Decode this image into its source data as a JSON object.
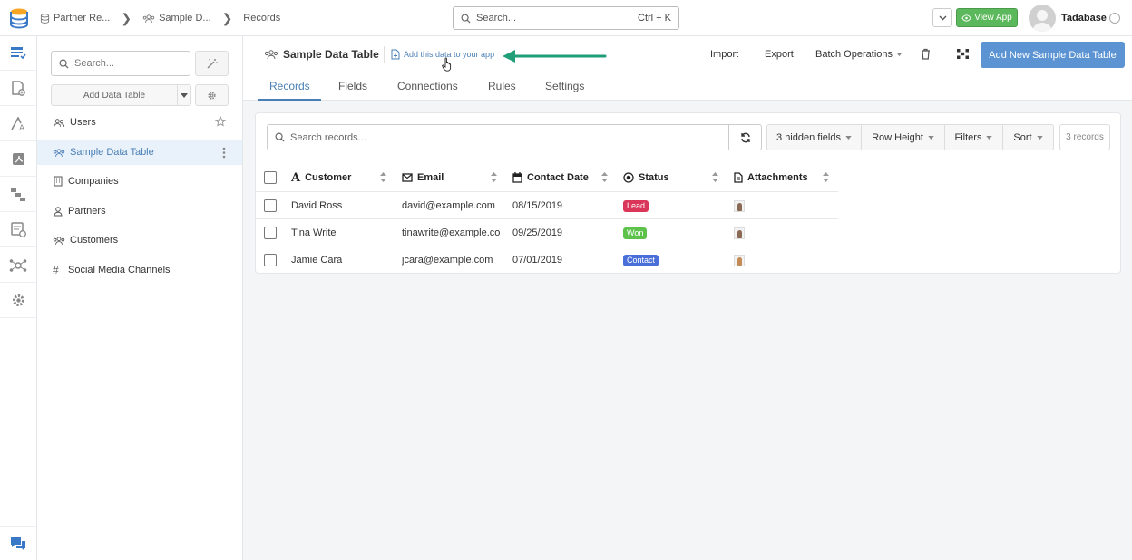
{
  "topbar": {
    "breadcrumbs": [
      {
        "label": "Partner Re...",
        "icon": "database-icon"
      },
      {
        "label": "Sample D...",
        "icon": "users-icon"
      },
      {
        "label": "Records",
        "icon": ""
      }
    ],
    "search": {
      "placeholder": "Search...",
      "shortcut": "Ctrl + K"
    },
    "view_app_label": "View App",
    "user_name": "Tadabase"
  },
  "rail": {
    "items": [
      "data-tables-icon",
      "pages-icon",
      "components-icon",
      "pdf-icon",
      "pipes-icon",
      "tasks-icon",
      "integrations-icon",
      "settings-icon"
    ],
    "bottom": "chat-icon"
  },
  "panel": {
    "search_placeholder": "Search...",
    "add_table_label": "Add Data Table",
    "tables": [
      {
        "label": "Users",
        "icon": "users-icon",
        "active": false
      },
      {
        "label": "Sample Data Table",
        "icon": "users-icon",
        "active": true
      },
      {
        "label": "Companies",
        "icon": "building-icon",
        "active": false
      },
      {
        "label": "Partners",
        "icon": "person-icon",
        "active": false
      },
      {
        "label": "Customers",
        "icon": "users-icon",
        "active": false
      },
      {
        "label": "Social Media Channels",
        "icon": "hash-icon",
        "active": false
      }
    ]
  },
  "header": {
    "title": "Sample Data Table",
    "add_link": "Add this data to your app",
    "import_label": "Import",
    "export_label": "Export",
    "batch_label": "Batch Operations",
    "add_new_label": "Add New Sample Data Table"
  },
  "tabs": [
    "Records",
    "Fields",
    "Connections",
    "Rules",
    "Settings"
  ],
  "toolbar": {
    "search_placeholder": "Search records...",
    "hidden_fields": "3 hidden fields",
    "row_height": "Row Height",
    "filters": "Filters",
    "sort": "Sort",
    "count": "3 records"
  },
  "columns": [
    {
      "label": "Customer",
      "icon": "text-icon"
    },
    {
      "label": "Email",
      "icon": "email-icon"
    },
    {
      "label": "Contact Date",
      "icon": "calendar-icon"
    },
    {
      "label": "Status",
      "icon": "radio-icon"
    },
    {
      "label": "Attachments",
      "icon": "file-icon"
    }
  ],
  "rows": [
    {
      "customer": "David Ross",
      "email": "david@example.com",
      "date": "08/15/2019",
      "status": "Lead",
      "status_color": "#d9365a"
    },
    {
      "customer": "Tina Write",
      "email": "tinawrite@example.com",
      "date": "09/25/2019",
      "status": "Won",
      "status_color": "#5cc24a"
    },
    {
      "customer": "Jamie Cara",
      "email": "jcara@example.com",
      "date": "07/01/2019",
      "status": "Contact",
      "status_color": "#4a6fd8"
    }
  ],
  "colors": {
    "accent": "#4a7fb5",
    "primary_button": "#5b93d3",
    "success": "#5cb85c",
    "arrow": "#1f9e78"
  }
}
